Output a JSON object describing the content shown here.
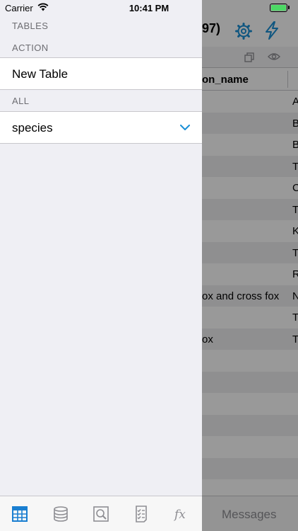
{
  "status_bar": {
    "carrier": "Carrier",
    "time": "10:41 PM"
  },
  "background": {
    "title": "97)",
    "column_header": "on_name",
    "rows": [
      {
        "c1": "",
        "c2": "A"
      },
      {
        "c1": "",
        "c2": "B"
      },
      {
        "c1": "",
        "c2": "B"
      },
      {
        "c1": "",
        "c2": "T"
      },
      {
        "c1": "",
        "c2": "C"
      },
      {
        "c1": "",
        "c2": "T"
      },
      {
        "c1": "",
        "c2": "K"
      },
      {
        "c1": "",
        "c2": "T"
      },
      {
        "c1": "",
        "c2": "R"
      },
      {
        "c1": "ox and cross fox",
        "c2": "N"
      },
      {
        "c1": "",
        "c2": "T"
      },
      {
        "c1": "ox",
        "c2": "T"
      },
      {
        "c1": "",
        "c2": ""
      },
      {
        "c1": "",
        "c2": ""
      },
      {
        "c1": "",
        "c2": ""
      },
      {
        "c1": "",
        "c2": ""
      },
      {
        "c1": "",
        "c2": ""
      },
      {
        "c1": "",
        "c2": ""
      },
      {
        "c1": "",
        "c2": ""
      }
    ],
    "messages_label": "Messages"
  },
  "drawer": {
    "header": "TABLES",
    "action_section": "ACTION",
    "new_table": "New Table",
    "all_section": "ALL",
    "selected_table": "species"
  },
  "tabbar": {
    "items": [
      "tables-icon",
      "database-icon",
      "query-icon",
      "checklist-icon",
      "function-icon"
    ],
    "active_color": "#1a7fd1"
  },
  "colors": {
    "accent": "#1a8fd6",
    "drawer_bg": "#efeff4"
  }
}
